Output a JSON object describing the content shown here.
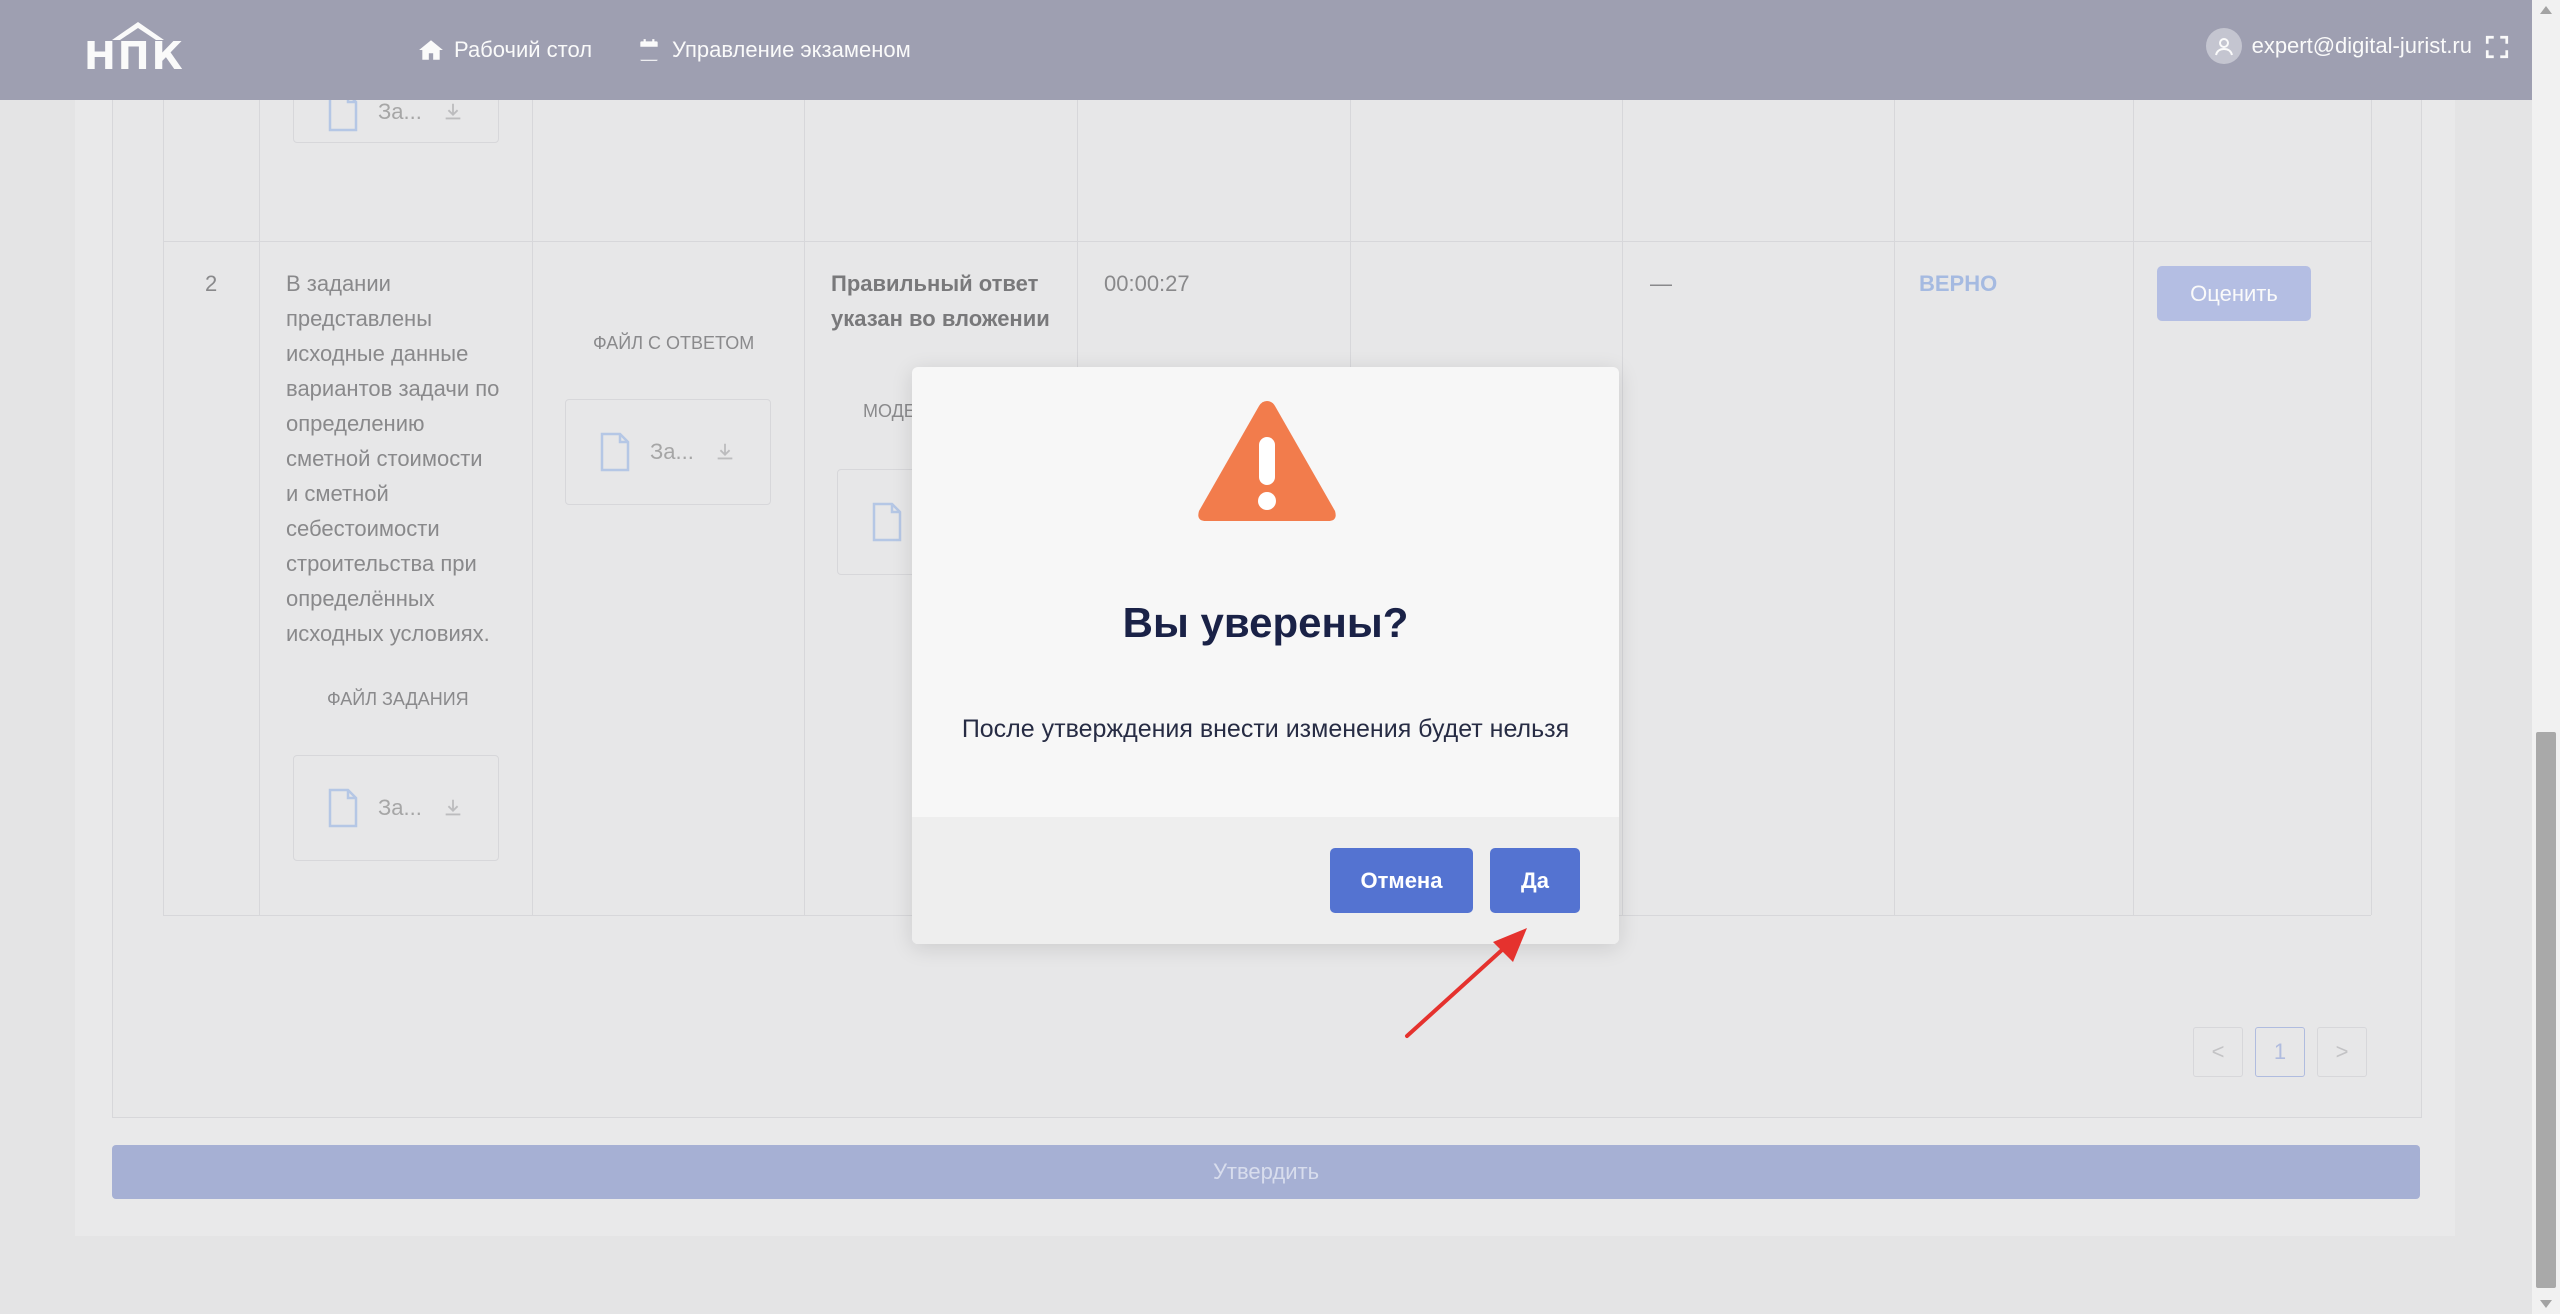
{
  "header": {
    "logo_text": "НПК",
    "nav": [
      {
        "label": "Рабочий стол",
        "icon": "home-icon"
      },
      {
        "label": "Управление экзаменом",
        "icon": "calendar-icon"
      }
    ],
    "user_email": "expert@digital-jurist.ru"
  },
  "table": {
    "row_number": "2",
    "task_text_lines": [
      "В задании",
      "представлены",
      "исходные данные",
      "вариантов задачи по",
      "определению",
      "сметной стоимости",
      "и сметной",
      "себестоимости",
      "строительства при",
      "определённых",
      "исходных условиях."
    ],
    "task_file_label": "ФАЙЛ ЗАДАНИЯ",
    "answer_file_label": "ФАЙЛ С ОТВЕТОМ",
    "file_name": "За...",
    "correct_answer_lines": [
      "Правильный ответ",
      "указан во вложении"
    ],
    "model_label": "МОДЕ",
    "time": "00:00:27",
    "dash": "—",
    "status": "ВЕРНО",
    "evaluate_button": "Оценить"
  },
  "pagination": {
    "prev": "<",
    "page": "1",
    "next": ">"
  },
  "approve_button": "Утвердить",
  "dialog": {
    "title": "Вы уверены?",
    "message": "После утверждения внести изменения будет нельзя",
    "cancel_label": "Отмена",
    "confirm_label": "Да",
    "warning_color": "#f27c4c",
    "button_color": "#5473d1"
  }
}
